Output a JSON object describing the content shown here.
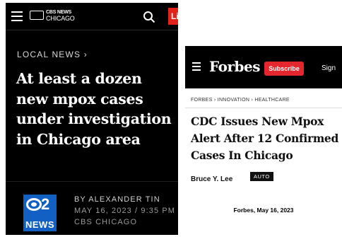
{
  "cbs": {
    "logo_line1": "CBS NEWS",
    "logo_line2": "CHICAGO",
    "logo_mark": "CBS",
    "live_tab": "Li",
    "section": "LOCAL NEWS ›",
    "headline": "At least a dozen new mpox cases under investigation in Chicago area",
    "badge_number": "2",
    "badge_label": "NEWS",
    "author": "BY ALEXANDER TIN",
    "date": "MAY 16, 2023 / 9:35 PM",
    "station": "CBS CHICAGO",
    "colors": {
      "background": "#000000",
      "live": "#e2231a",
      "badge": "#1260c4"
    },
    "icons": [
      "menu-icon",
      "search-icon"
    ]
  },
  "forbes": {
    "logo": "Forbes",
    "subscribe_label": "Subscribe",
    "signin_label": "Sign",
    "breadcrumb": "FORBES › INNOVATION › HEALTHCARE",
    "headline": "CDC Issues New Mpox Alert After 12 Confirmed Cases In Chicago",
    "author": "Bruce Y. Lee",
    "author_tag": "AUTO",
    "colors": {
      "header": "#000000",
      "subscribe": "#e4272e"
    },
    "icons": [
      "menu-icon"
    ]
  },
  "caption": "Forbes, May 16, 2023"
}
